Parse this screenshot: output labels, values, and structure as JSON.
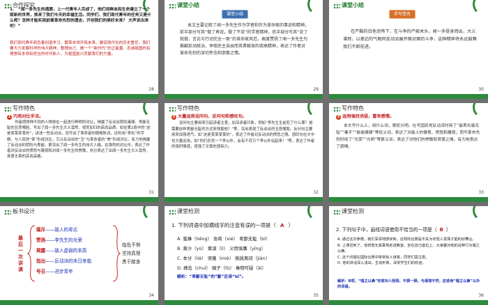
{
  "s28": {
    "title": "合作探究",
    "question": "1.　“闻一多先生的遗愿，上一代青年人完成了，他们用鲜血和生命建立了一个崭新的世界，换来了我们今天的幸福生活。同学们，我们现代青年的任务又是什么呢？怎样才能实现前辈革命先烈的遗志，开创我们的美好未来？ 大声说出来吧！”",
    "answer": "我们现代青年肩负着创造学习、繁荣本领开拓未来、建设现代化的历史重任，我们要大力发展科学的伟大精神、整理自己、做一个“新时代”的正能量、忠诚祖国的有理想有本领有担当的时代新人，为祖国复兴贡献我们的力量。",
    "page": "28"
  },
  "s29": {
    "title": "课堂小结",
    "badge": "课堂小结",
    "body": "本文主要记叙了闻一多先生作为学者和作为革命家的事迹和精神。前半部分写其“做了再说，做了不说”的学者精神，后半部分写其“说了就做，言论与行动完全一致”的革命家风范，高度赞扬了闻一多先生为推翻反动统治、争取民主自由而英勇献身的崇高精神，表达了作者对革命先烈的深切怀念和崇敬之情。",
    "page": "29"
  },
  "s30": {
    "title": "课堂小结",
    "badge": "手写签名",
    "body": "在严酷的白色恐怖下，在斗争的严峻关头，闻一多挺身而出，大义凛然，以豪迈的气概同反动派展开面对面的斗争，这种精神将永远鼓舞我们不断前进。",
    "page": "30"
  },
  "s31": {
    "title": "写作特色",
    "point": "巧用对比手法。",
    "body": "作者把两种不同的人物放在一起进行鲜明的对比，揭露了反动派阴险毒辣、卑鄙无耻的丑恶嘴脸，写出了闻一多先生大义凛然、视死如归的高尚品质。如在第2段中的“这是某某某某的”，讲述一些反动派，另写出了革命者的慷慨陈词，还利用“卑劣”的字眼，与人民的“笑”形成对比，又以反动派的“丑”与革命者的“美”形成对比，有力地揭露了反动派的阴险与卑鄙，更突出了闻一多先生的伟大人格。在强烈的对比中，表达了作者对反动派的愤怒与蔑视和对闻一多先生的崇敬，充分表达了出闻一多先生大义凛然、英勇无畏的高尚品格。",
    "page": "31"
  },
  "s32": {
    "title": "写作特色",
    "point": "大量运用设问句、反问句和感叹句。",
    "body": "设问句主要用来引起读者注意，加深读者印象，例如“李先生生前犯了什么罪？是需要这样卑鄙无耻的方式来残害他？”等，突出表现了反动派的丑恶嘴脸。反问句主要用来加强语气，如“这是某某某某的”，表达了作者对反动派的愤怒之情。感叹句在文中也大量运用，如“你们杀死一个李公朴，会有千百万个李公朴站起来！”等，表达了作者的强烈情感，增强了文章的感染力。",
    "page": "32"
  },
  "s33": {
    "title": "写作特色",
    "point": "运用强烈词语，富有感情。",
    "body": "本文写什么人，用什么词，褒贬分明。在写国民党反动派时用了“最卑劣最无耻”“毒手”“偷偷摸摸”等贬义词，表达了对敌人的憎恨、愤怒和蔑视；而写革命先烈时用了“光荣”“光明”等褒义词，表达了对他们的崇敬和赞美之情，有力地表达了感情。",
    "page": "33"
  },
  "s34": {
    "title": "板书设计",
    "left_label": "最后一次讲演",
    "rows": [
      {
        "k": "痛斥",
        "v": "——敌人的卑劣"
      },
      {
        "k": "赞扬",
        "v": "——李先生的光荣"
      },
      {
        "k": "揭露",
        "v": "——敌人虚弱的本质"
      },
      {
        "k": "指出",
        "v": "——反动派的末日来临"
      },
      {
        "k": "号召",
        "v": "——进步青年"
      }
    ],
    "right": [
      "临危不惧",
      "坚持真理",
      "勇于献身"
    ],
    "page": "34"
  },
  "s35": {
    "title": "课堂检测",
    "question": "1. 下列词语中加横线字的注音有误的一项是（",
    "answer": "A",
    "question_end": "）",
    "options": [
      "A. 蜜蜂（hēng）  协商（xié）  卑鄙无耻（bí）",
      "B. 黄沙（yù）  筹谋（lì）  义愤填膺（yīng）",
      "C. 本分（liè）  诬蔑（miè）  挑拨离间（jiàn）",
      "D. 搏击（chuí）  贼子（fù）  毒物可疑（āi）"
    ],
    "analysis": "解析：“卑鄙无耻”的“鄙”应读“bǐ”。",
    "page": "35"
  },
  "s36": {
    "title": "课堂检测",
    "question": "2. 下列句子中，画线词语使用不恰当的一项是（",
    "answer": "B",
    "question_end": "）",
    "options": [
      "A. 通过这次参赛，我们深深地感受到，这样的比赛是不失为年轻人发挥才能的好舞台。",
      "B. 上课迟到了，他却若无其事地走进教室，坐在自己座位上，大家都对他的这种行为嗤之以鼻。",
      "C. 这个问题在国际比赛中常常有人误答，同学们需注意。",
      "D. 他的讲话深入浅出，生动形象，深受学生们的欢迎。"
    ],
    "analysis": "解析：B项，“嗤之以鼻”形容对人轻视、不屑一顾，与语境不符，应该用“嗤之以鼻”以外的词语。",
    "page": "36"
  }
}
